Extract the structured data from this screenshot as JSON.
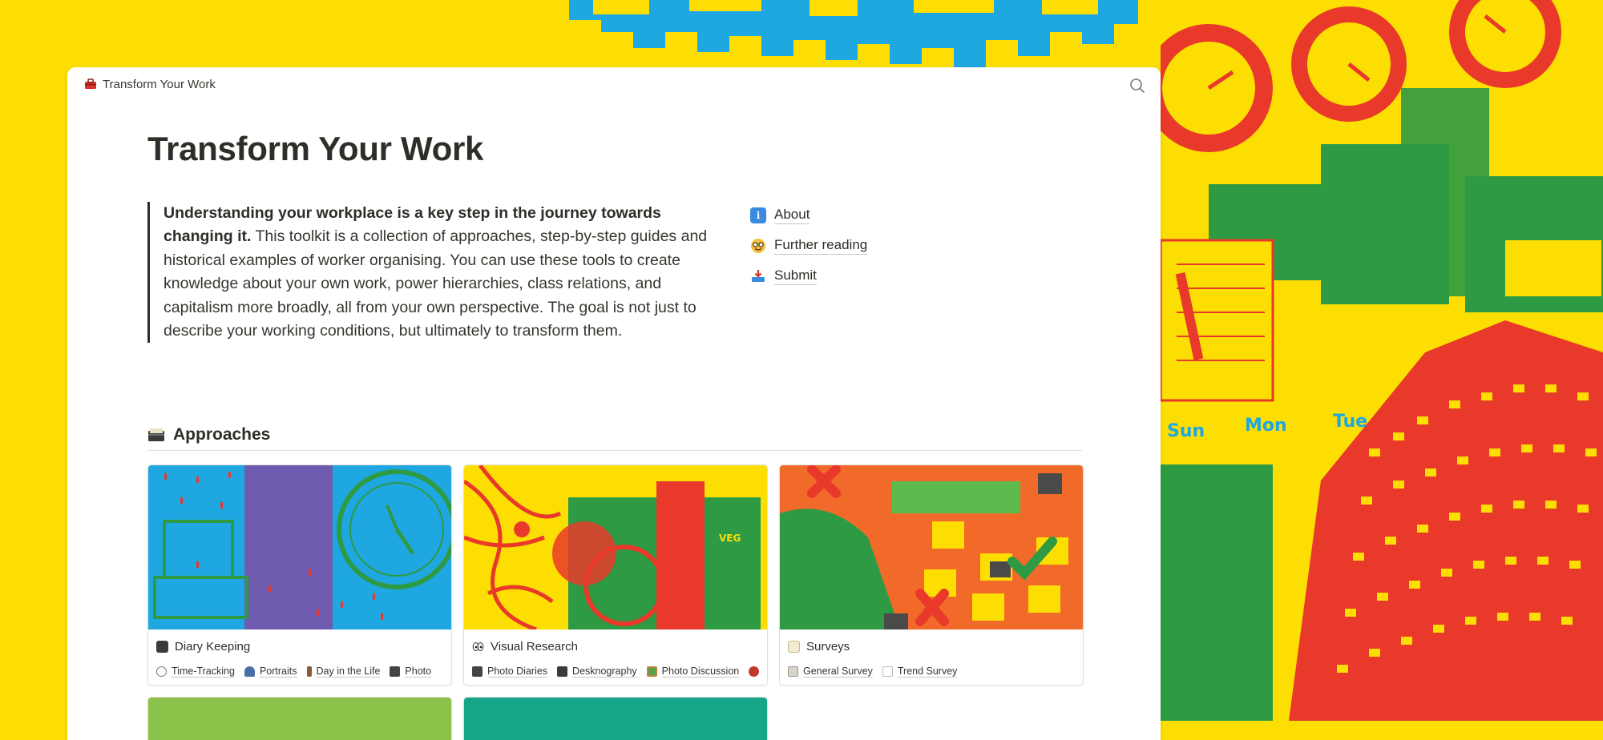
{
  "colors": {
    "background": "#FDDE02",
    "accent_red": "#E8392A",
    "accent_blue": "#1EA7E1",
    "accent_green": "#2E9A44",
    "text": "#2f2d28"
  },
  "breadcrumb": {
    "icon": "toolbox-icon",
    "label": "Transform Your Work"
  },
  "search": {
    "icon": "search-icon"
  },
  "page": {
    "title": "Transform Your Work",
    "intro_bold": "Understanding your workplace is a key step in the journey towards changing it.",
    "intro_rest": " This toolkit is a collection of approaches, step-by-step guides and historical examples of worker organising. You can use these tools to create knowledge about your own work, power hierarchies, class relations, and capitalism more broadly, all from your own perspective. The goal is not just to describe your working conditions, but ultimately to transform them."
  },
  "links": [
    {
      "icon": "info-icon",
      "label": "About"
    },
    {
      "icon": "nerd-face-icon",
      "label": "Further reading"
    },
    {
      "icon": "inbox-tray-icon",
      "label": "Submit"
    }
  ],
  "approaches": {
    "icon": "card-file-box-icon",
    "heading": "Approaches",
    "cards": [
      {
        "title": "Diary Keeping",
        "icon": "notebook-icon",
        "tags": [
          {
            "icon": "clock-icon",
            "label": "Time-Tracking"
          },
          {
            "icon": "bust-icon",
            "label": "Portraits"
          },
          {
            "icon": "walking-person-icon",
            "label": "Day in the Life"
          },
          {
            "icon": "camera-icon",
            "label": "Photo"
          }
        ]
      },
      {
        "title": "Visual Research",
        "icon": "eyes-icon",
        "tags": [
          {
            "icon": "camera-icon",
            "label": "Photo Diaries"
          },
          {
            "icon": "card-file-box-icon",
            "label": "Deskn​ography"
          },
          {
            "icon": "framed-picture-icon",
            "label": "Photo Discussion"
          },
          {
            "icon": "speech-icon",
            "label": ""
          }
        ]
      },
      {
        "title": "Surveys",
        "icon": "memo-icon",
        "tags": [
          {
            "icon": "clipboard-icon",
            "label": "General Survey"
          },
          {
            "icon": "chart-up-icon",
            "label": "Trend Survey"
          }
        ]
      }
    ]
  }
}
